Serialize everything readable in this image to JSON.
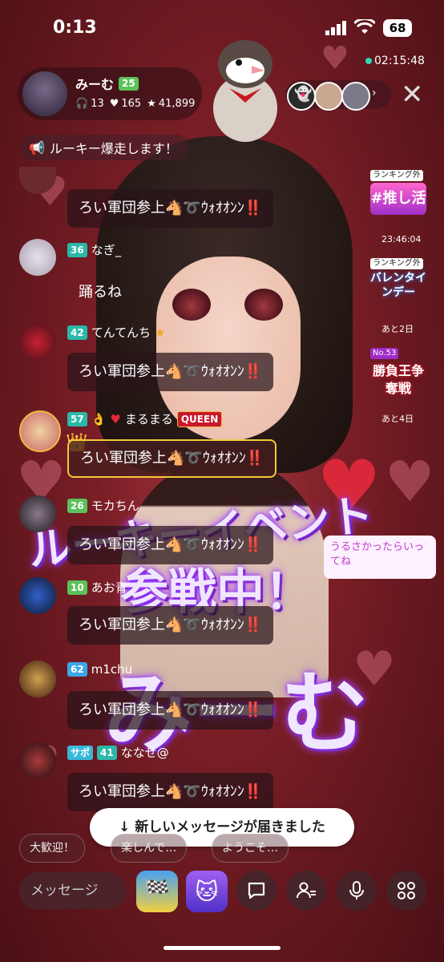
{
  "status_bar": {
    "time": "0:13",
    "battery": "68"
  },
  "streamer": {
    "name": "みーむ",
    "level": "25",
    "listeners": "13",
    "likes": "165",
    "stars": "41,899"
  },
  "stream_timer": "02:15:48",
  "announcement": "ルーキー爆走します！",
  "ranking_panel": {
    "item1_tag": "ランキング外",
    "item1_label": "#推し活",
    "item1_time": "23:46:04",
    "item2_tag": "ランキング外",
    "item2_label": "バレンタインデー",
    "item2_time": "あと2日",
    "item3_tag": "No.53",
    "item3_label": "勝負王争奪戦",
    "item3_time": "あと4日"
  },
  "background_text": {
    "line1": "ルーキーイベント",
    "line2": "参戦中！",
    "line3": "みーむ"
  },
  "floating_bubble": "うるさかったらいってね",
  "messages": [
    {
      "user": "",
      "level": "",
      "text": "ろい軍団参上🐴➰ｳｫｵｵﾝﾝ‼️"
    },
    {
      "user": "なぎ_",
      "level": "36",
      "text": "踊るね"
    },
    {
      "user": "てんてんち",
      "level": "42",
      "text": "ろい軍団参上🐴➰ｳｫｵｵﾝﾝ‼️"
    },
    {
      "user": "まるまる",
      "level": "57",
      "text": "ろい軍団参上🐴➰ｳｫｵｵﾝﾝ‼️",
      "user_badge": "QUEEN"
    },
    {
      "user": "モカちん",
      "level": "26",
      "text": "ろい軍団参上🐴➰ｳｫｵｵﾝﾝ‼️"
    },
    {
      "user": "あお青",
      "level": "10",
      "text": "ろい軍団参上🐴➰ｳｫｵｵﾝﾝ‼️"
    },
    {
      "user": "m1chu",
      "level": "62",
      "text": "ろい軍団参上🐴➰ｳｫｵｵﾝﾝ‼️"
    },
    {
      "user": "ななせ@",
      "level": "41",
      "support": "サポ",
      "text": "ろい軍団参上🐴➰ｳｫｵｵﾝﾝ‼️"
    }
  ],
  "new_message_banner": "↓ 新しいメッセージが届きました",
  "quick_replies": [
    "大歓迎！",
    "楽しんで…",
    "ようこそ…"
  ],
  "message_input": {
    "placeholder": "メッセージ"
  },
  "colors": {
    "accent_pink": "#ff5a8a",
    "level_green": "#5cc15a",
    "level_teal": "#2cb8a8",
    "level_blue": "#3ba6e8"
  }
}
